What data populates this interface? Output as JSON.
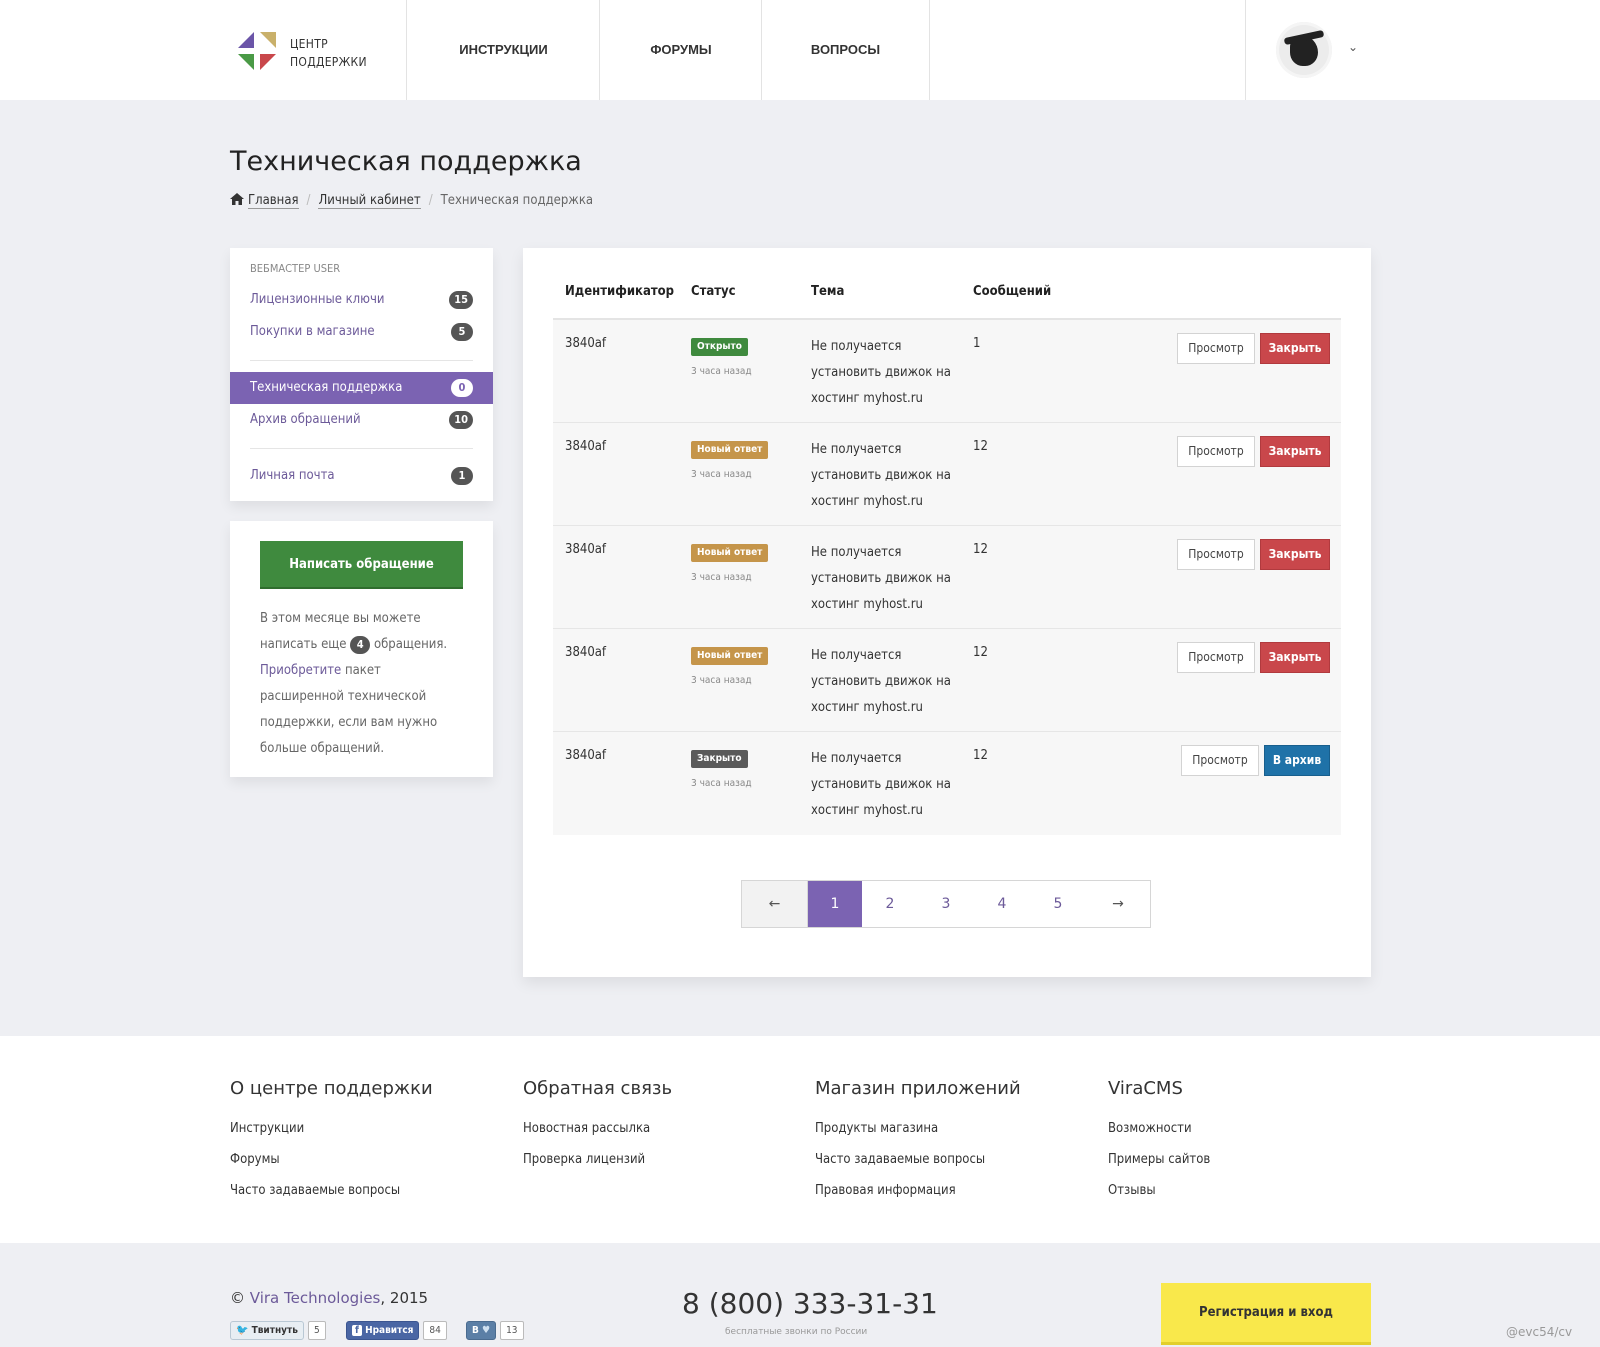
{
  "header": {
    "logo_line1": "ЦЕНТР",
    "logo_line2": "ПОДДЕРЖКИ",
    "nav": [
      "ИНСТРУКЦИИ",
      "ФОРУМЫ",
      "ВОПРОСЫ"
    ],
    "avatar_icon": "user-avatar-icon",
    "chevron": "⌄"
  },
  "page": {
    "title": "Техническая поддержка",
    "breadcrumb": {
      "home": "Главная",
      "cabinet": "Личный кабинет",
      "current": "Техническая поддержка",
      "sep": "/"
    }
  },
  "sidebar": {
    "heading": "ВЕБМАСТЕР USER",
    "items": [
      {
        "label": "Лицензионные ключи",
        "count": "15"
      },
      {
        "label": "Покупки в магазине",
        "count": "5"
      },
      {
        "label": "Техническая поддержка",
        "count": "0"
      },
      {
        "label": "Архив обращений",
        "count": "10"
      },
      {
        "label": "Личная почта",
        "count": "1"
      }
    ],
    "new_button": "Написать обращение",
    "info": {
      "part1": "В этом месяце вы можете написать еще",
      "count": "4",
      "part2": "обращения.",
      "link": "Приобретите",
      "part3": "пакет расширенной технической поддержки, если вам нужно больше обращений."
    }
  },
  "table": {
    "headers": [
      "Идентификатор",
      "Статус",
      "Тема",
      "Сообщений"
    ],
    "rows": [
      {
        "id": "3840af",
        "status": "Открыто",
        "ago": "3 часа назад",
        "topic": "Не получается установить движок на хостинг myhost.ru",
        "count": "1",
        "view": "Просмотр",
        "action": "Закрыть"
      },
      {
        "id": "3840af",
        "status": "Новый ответ",
        "ago": "3 часа назад",
        "topic": "Не получается установить движок на хостинг myhost.ru",
        "count": "12",
        "view": "Просмотр",
        "action": "Закрыть"
      },
      {
        "id": "3840af",
        "status": "Новый ответ",
        "ago": "3 часа назад",
        "topic": "Не получается установить движок на хостинг myhost.ru",
        "count": "12",
        "view": "Просмотр",
        "action": "Закрыть"
      },
      {
        "id": "3840af",
        "status": "Новый ответ",
        "ago": "3 часа назад",
        "topic": "Не получается установить движок на хостинг myhost.ru",
        "count": "12",
        "view": "Просмотр",
        "action": "Закрыть"
      },
      {
        "id": "3840af",
        "status": "Закрыто",
        "ago": "3 часа назад",
        "topic": "Не получается установить движок на хостинг myhost.ru",
        "count": "12",
        "view": "Просмотр",
        "action": "В архив"
      }
    ]
  },
  "pagination": {
    "prev": "←",
    "pages": [
      "1",
      "2",
      "3",
      "4",
      "5"
    ],
    "next": "→",
    "current": "1"
  },
  "footer": {
    "columns": [
      {
        "title": "О центре поддержки",
        "links": [
          "Инструкции",
          "Форумы",
          "Часто задаваемые вопросы"
        ]
      },
      {
        "title": "Обратная связь",
        "links": [
          "Новостная рассылка",
          "Проверка лицензий"
        ]
      },
      {
        "title": "Магазин приложений",
        "links": [
          "Продукты магазина",
          "Часто задаваемые вопросы",
          "Правовая информация"
        ]
      },
      {
        "title": "ViraCMS",
        "links": [
          "Возможности",
          "Примеры сайтов",
          "Отзывы"
        ]
      }
    ],
    "copyright_symbol": "©",
    "company": "Vira Technologies",
    "year": ", 2015",
    "social": [
      {
        "label": "Твитнуть",
        "count": "5"
      },
      {
        "label": "Нравится",
        "count": "84"
      },
      {
        "label": "В",
        "count": "13"
      }
    ],
    "phone": "8 (800) 333-31-31",
    "phone_note": "бесплатные звонки по России",
    "register": "Регистрация и вход",
    "credit": "@evc54/cv"
  },
  "colors": {
    "accent": "#7b63b2",
    "green": "#3f8a3e",
    "red": "#c9474b",
    "blue": "#1f72a8",
    "gold": "#c5954a",
    "yellow": "#f9e84b"
  }
}
